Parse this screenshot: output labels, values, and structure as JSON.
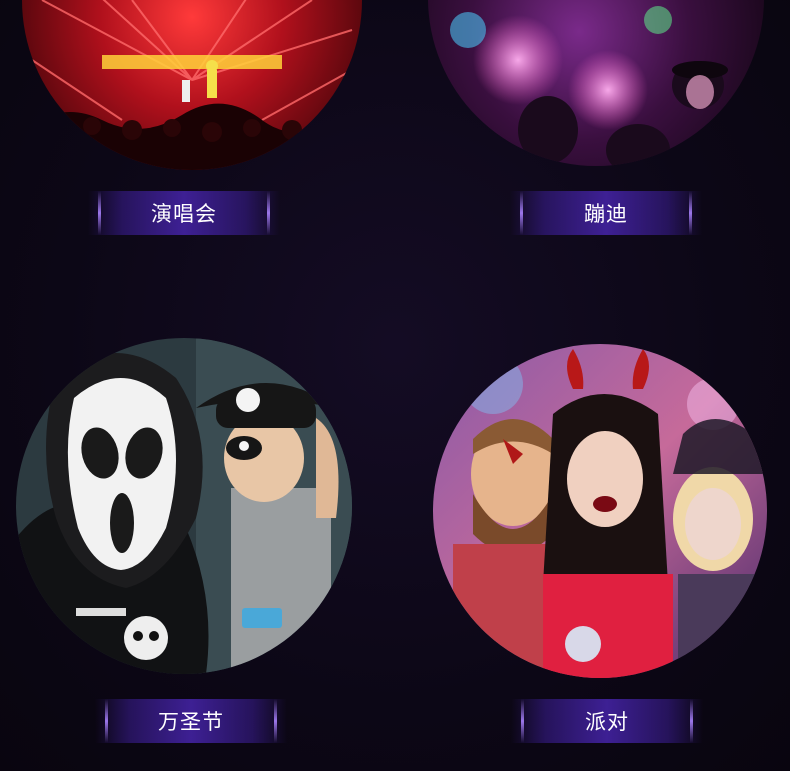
{
  "scenes": [
    {
      "label": "演唱会",
      "image": "concert-stage-crowd-red-lights"
    },
    {
      "label": "蹦迪",
      "image": "nightclub-dancing-crowd-pink-lights"
    },
    {
      "label": "万圣节",
      "image": "halloween-scream-mask-pirate-child"
    },
    {
      "label": "派对",
      "image": "party-friends-vampire-devil-horns"
    }
  ],
  "colors": {
    "background": "#0c0716",
    "label_bar": "#4624aa",
    "label_text": "#ffffff"
  }
}
